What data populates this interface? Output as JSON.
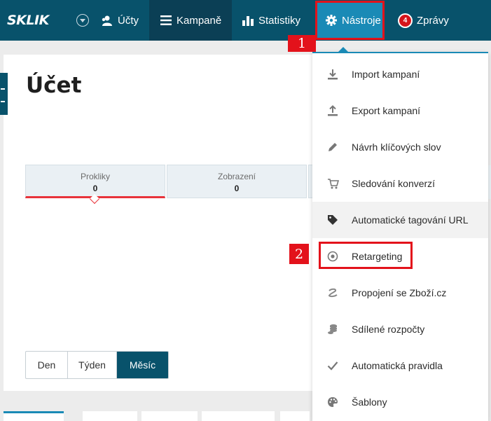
{
  "brand": {
    "logo_text": "SKLIK",
    "primary": "#08526b",
    "accent": "#1a8ab6",
    "highlight": "#e3121b"
  },
  "nav": {
    "accounts": {
      "label": "Účty",
      "icon": "user-icon"
    },
    "campaigns": {
      "label": "Kampaně",
      "icon": "hamburger-icon"
    },
    "statistics": {
      "label": "Statistiky",
      "icon": "bar-chart-icon"
    },
    "tools": {
      "label": "Nástroje",
      "icon": "gear-icon"
    },
    "messages": {
      "label": "Zprávy",
      "badge": "4"
    }
  },
  "page": {
    "title": "Účet"
  },
  "metrics": [
    {
      "label": "Prokliky",
      "value": "0"
    },
    {
      "label": "Zobrazení",
      "value": "0"
    }
  ],
  "period": {
    "day": "Den",
    "week": "Týden",
    "month": "Měsíc",
    "selected": "Měsíc"
  },
  "tools_menu": [
    {
      "label": "Import kampaní",
      "icon": "download-icon"
    },
    {
      "label": "Export kampaní",
      "icon": "upload-icon"
    },
    {
      "label": "Návrh klíčových slov",
      "icon": "pencil-icon"
    },
    {
      "label": "Sledování konverzí",
      "icon": "cart-icon"
    },
    {
      "label": "Automatické tagování URL",
      "icon": "tag-icon"
    },
    {
      "label": "Retargeting",
      "icon": "target-icon"
    },
    {
      "label": "Propojení se Zboží.cz",
      "icon": "zbozi-icon"
    },
    {
      "label": "Sdílené rozpočty",
      "icon": "coins-icon"
    },
    {
      "label": "Automatická pravidla",
      "icon": "check-icon"
    },
    {
      "label": "Šablony",
      "icon": "palette-icon"
    }
  ],
  "steps": {
    "one": "1",
    "two": "2"
  }
}
